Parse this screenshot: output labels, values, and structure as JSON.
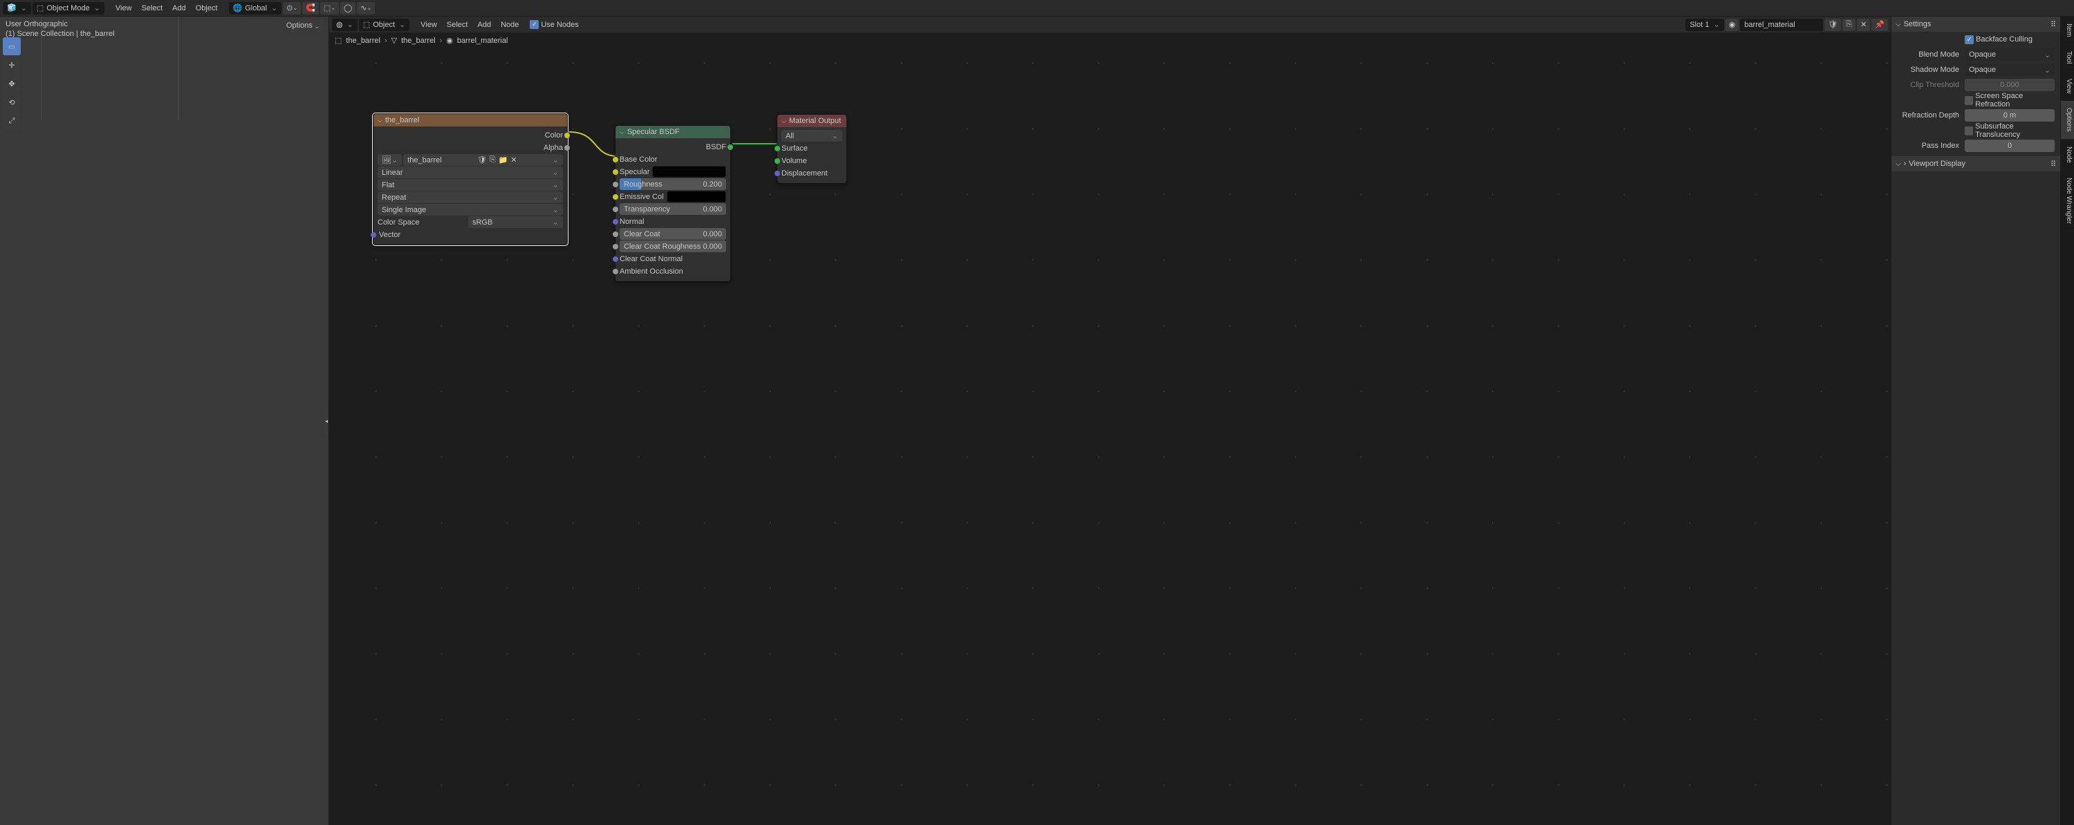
{
  "viewport_header": {
    "editor_icon": "editor-3d",
    "mode": "Object Mode",
    "menus": [
      "View",
      "Select",
      "Add",
      "Object"
    ],
    "orientation": "Global",
    "options": "Options"
  },
  "vp_info": {
    "line1": "User Orthographic",
    "line2": "(1) Scene Collection | the_barrel"
  },
  "node_header": {
    "object_label": "Object",
    "menus": [
      "View",
      "Select",
      "Add",
      "Node"
    ],
    "use_nodes": "Use Nodes",
    "slot": "Slot 1",
    "material": "barrel_material"
  },
  "breadcrumb": [
    "the_barrel",
    "the_barrel",
    "barrel_material"
  ],
  "texnode": {
    "title": "the_barrel",
    "out_color": "Color",
    "out_alpha": "Alpha",
    "imgname": "the_barrel",
    "interp": "Linear",
    "proj": "Flat",
    "ext": "Repeat",
    "source": "Single Image",
    "cs_label": "Color Space",
    "cs": "sRGB",
    "in_vector": "Vector"
  },
  "specnode": {
    "title": "Specular BSDF",
    "out": "BSDF",
    "base": "Base Color",
    "spec": "Specular",
    "rough": "Roughness",
    "rough_v": "0.200",
    "emis": "Emissive Col",
    "trans": "Transparency",
    "trans_v": "0.000",
    "norm": "Normal",
    "cc": "Clear Coat",
    "cc_v": "0.000",
    "ccr": "Clear Coat Roughness",
    "ccr_v": "0.000",
    "ccn": "Clear Coat Normal",
    "ao": "Ambient Occlusion"
  },
  "outnode": {
    "title": "Material Output",
    "target": "All",
    "surf": "Surface",
    "vol": "Volume",
    "disp": "Displacement"
  },
  "sidepanel": {
    "settings": "Settings",
    "backface": "Backface Culling",
    "blend_l": "Blend Mode",
    "blend_v": "Opaque",
    "shadow_l": "Shadow Mode",
    "shadow_v": "Opaque",
    "clip_l": "Clip Threshold",
    "clip_v": "0.000",
    "ssr": "Screen Space Refraction",
    "refr_l": "Refraction Depth",
    "refr_v": "0 m",
    "sss": "Subsurface Translucency",
    "pass_l": "Pass Index",
    "pass_v": "0",
    "vpd": "Viewport Display"
  },
  "vtabs": [
    "Item",
    "Tool",
    "View",
    "Options",
    "Node",
    "Node Wrangler"
  ]
}
